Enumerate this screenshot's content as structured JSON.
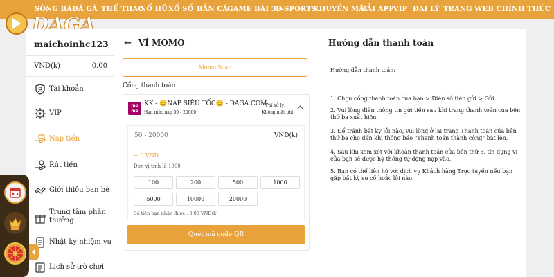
{
  "nav": {
    "items": [
      "SÒNG BÀI",
      "ĐÁ GÀ",
      "THỂ THAO",
      "NỔ HŨ",
      "XỔ SỐ",
      "BẮN CÁ",
      "GAME BÀI 3D",
      "E-SPORTS",
      "KHUYẾN MÃI",
      "TẢI APP",
      "VIP",
      "ĐẠI LÝ",
      "TRANG WEB CHÍNH THỨC"
    ]
  },
  "logo": {
    "text": "DAGA"
  },
  "sidebar": {
    "username": "maichoinhc123",
    "balance_label": "VND(k)",
    "balance_value": "0.00",
    "items": [
      {
        "label": "Tài khoản",
        "icon": "user-icon"
      },
      {
        "label": "VIP",
        "icon": "vip-icon"
      },
      {
        "label": "Nạp tiền",
        "icon": "deposit-icon"
      },
      {
        "label": "Rút tiền",
        "icon": "withdraw-icon"
      },
      {
        "label": "Giới thiệu bạn bè",
        "icon": "referral-icon"
      },
      {
        "label": "Trung tâm phần thưởng",
        "icon": "reward-icon"
      },
      {
        "label": "Nhật ký nhiệm vụ",
        "icon": "mission-icon"
      },
      {
        "label": "Lịch sử trò chơi",
        "icon": "history-icon"
      }
    ],
    "active_index": 2
  },
  "deposit": {
    "back_icon": "back-arrow-icon",
    "back_glyph": "←",
    "title": "VÍ MOMO",
    "momo_scan": "Momo Scan",
    "gateway_label": "Cổng thanh toán",
    "gateway": {
      "logo_text": "mo mo",
      "name": "KK - 😊NẠP SIÊU TỐC😊 - DAGA.COM",
      "limit": "Hạn mức nạp 50 - 20000",
      "fee_line1": "Phí xử lý:",
      "fee_line2": "Không mất phí"
    },
    "amount_placeholder": "50 - 20000",
    "currency": "VND(k)",
    "plus_value": "+ 0 VND",
    "unit_note": "Đơn vị tính là 1000",
    "chips": [
      "100",
      "200",
      "500",
      "1000",
      "5000",
      "10000",
      "20000"
    ],
    "receive_note": "Số tiền bạn nhận được : 0.00 VND(k)",
    "qr_button": "Quét mã code QR"
  },
  "guide": {
    "title": "Hướng dẫn thanh toán",
    "subtitle": "Hướng dẫn thanh toán:",
    "steps": [
      "1. Chọn cổng thanh toán của bạn > Điền số tiền gửi > Gửi.",
      "2. Vui lòng điền thông tin gửi tiền sau khi trang thanh toán của bên thứ ba xuất hiện.",
      "3. Để tránh bất kỳ lỗi nào, vui lòng ở lại trang Thanh toán của bên thứ ba cho đến khi thông báo \"Thanh toán thành công\" bật lên.",
      "4. Sau khi xem xét với khoản thanh toán của bên thứ 3, tín dụng ví của bạn sẽ được hệ thống tự động nạp vào.",
      "5. Bạn có thể liên hệ với dịch vụ Khách hàng Trực tuyến nếu bạn gặp bất kỳ sự cố hoặc lỗi nào."
    ]
  },
  "colors": {
    "accent": "#e8a33d",
    "momo": "#a50064",
    "page_bg": "#efeff0"
  }
}
